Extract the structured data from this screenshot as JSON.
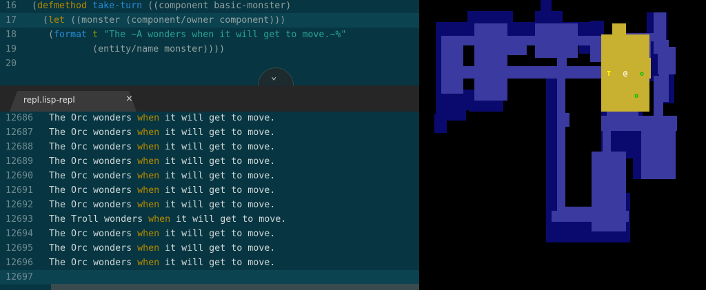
{
  "editor": {
    "code_lines": [
      {
        "num": "16",
        "parts": [
          [
            "plain",
            "("
          ],
          [
            "kw",
            "defmethod"
          ],
          [
            "plain",
            " "
          ],
          [
            "fn",
            "take-turn"
          ],
          [
            "plain",
            " ((component basic-monster)"
          ]
        ]
      },
      {
        "num": "17",
        "parts": [
          [
            "plain",
            "  ("
          ],
          [
            "kw",
            "let"
          ],
          [
            "plain",
            " ((monster (component/owner component)))"
          ]
        ]
      },
      {
        "num": "18",
        "parts": [
          [
            "plain",
            "   ("
          ],
          [
            "fn",
            "format"
          ],
          [
            "plain",
            " "
          ],
          [
            "sym",
            "t"
          ],
          [
            "plain",
            " "
          ],
          [
            "str",
            "\"The ~A wonders when it will get to move.~%\""
          ]
        ]
      },
      {
        "num": "19",
        "parts": [
          [
            "plain",
            "           (entity/name monster))))"
          ]
        ]
      },
      {
        "num": "20",
        "parts": []
      }
    ],
    "fold_icon": "chevron-down-icon",
    "tab": {
      "label": "repl.lisp-repl",
      "close": "×"
    },
    "repl_lines": [
      {
        "num": "12686",
        "pre": "The Orc wonders ",
        "kw": "when",
        "post": " it will get to move."
      },
      {
        "num": "12687",
        "pre": "The Orc wonders ",
        "kw": "when",
        "post": " it will get to move."
      },
      {
        "num": "12688",
        "pre": "The Orc wonders ",
        "kw": "when",
        "post": " it will get to move."
      },
      {
        "num": "12689",
        "pre": "The Orc wonders ",
        "kw": "when",
        "post": " it will get to move."
      },
      {
        "num": "12690",
        "pre": "The Orc wonders ",
        "kw": "when",
        "post": " it will get to move."
      },
      {
        "num": "12691",
        "pre": "The Orc wonders ",
        "kw": "when",
        "post": " it will get to move."
      },
      {
        "num": "12692",
        "pre": "The Orc wonders ",
        "kw": "when",
        "post": " it will get to move."
      },
      {
        "num": "12693",
        "pre": "The Troll wonders ",
        "kw": "when",
        "post": " it will get to move."
      },
      {
        "num": "12694",
        "pre": "The Orc wonders ",
        "kw": "when",
        "post": " it will get to move."
      },
      {
        "num": "12695",
        "pre": "The Orc wonders ",
        "kw": "when",
        "post": " it will get to move."
      },
      {
        "num": "12696",
        "pre": "The Orc wonders ",
        "kw": "when",
        "post": " it will get to move."
      },
      {
        "num": "12697",
        "pre": "",
        "kw": "",
        "post": ""
      }
    ]
  },
  "game": {
    "glyphs": {
      "troll": "T",
      "player": "@",
      "orc_1": "o",
      "orc_2": "o"
    },
    "colors": {
      "explored": "#0a0a6e",
      "room": "#3a3aa0",
      "visible": "#c8b030",
      "troll": "#ffff00",
      "orc": "#00c000",
      "player": "#ffffff"
    }
  }
}
